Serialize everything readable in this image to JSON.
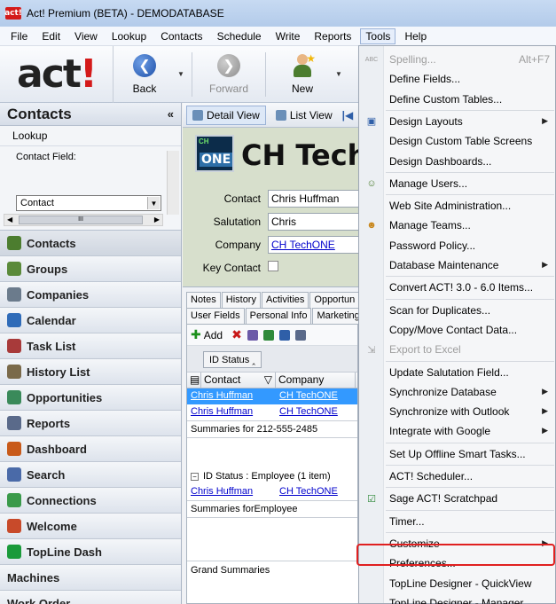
{
  "window": {
    "app_icon": "act!",
    "title": "Act! Premium (BETA) - DEMODATABASE"
  },
  "menubar": {
    "items": [
      {
        "label": "File"
      },
      {
        "label": "Edit"
      },
      {
        "label": "View"
      },
      {
        "label": "Lookup"
      },
      {
        "label": "Contacts"
      },
      {
        "label": "Schedule"
      },
      {
        "label": "Write"
      },
      {
        "label": "Reports"
      },
      {
        "label": "Tools",
        "active": true
      },
      {
        "label": "Help"
      }
    ]
  },
  "toolbar": {
    "logo_text": "act",
    "logo_bang": "!",
    "back_label": "Back",
    "forward_label": "Forward",
    "new_label": "New"
  },
  "leftnav": {
    "header": "Contacts",
    "collapse_glyph": "«",
    "lookup": {
      "title": "Lookup",
      "field_label": "Contact Field:",
      "field_value": "Contact",
      "scroll_thumb": "III"
    },
    "items": [
      {
        "label": "Contacts",
        "icon": "contacts-icon",
        "color": "#4c7d2f"
      },
      {
        "label": "Groups",
        "icon": "groups-icon",
        "color": "#5a8a3a"
      },
      {
        "label": "Companies",
        "icon": "companies-icon",
        "color": "#6b7b8c"
      },
      {
        "label": "Calendar",
        "icon": "calendar-icon",
        "color": "#2f6bb8"
      },
      {
        "label": "Task List",
        "icon": "task-list-icon",
        "color": "#a83a3a"
      },
      {
        "label": "History List",
        "icon": "history-list-icon",
        "color": "#7a6a4a"
      },
      {
        "label": "Opportunities",
        "icon": "opportunities-icon",
        "color": "#3a8a5a"
      },
      {
        "label": "Reports",
        "icon": "reports-icon",
        "color": "#5a6a8a"
      },
      {
        "label": "Dashboard",
        "icon": "dashboard-icon",
        "color": "#c85a1a"
      },
      {
        "label": "Search",
        "icon": "search-icon",
        "color": "#4a6aa8"
      },
      {
        "label": "Connections",
        "icon": "connections-icon",
        "color": "#3a9a4a"
      },
      {
        "label": "Welcome",
        "icon": "welcome-icon",
        "color": "#c84a2a"
      },
      {
        "label": "TopLine Dash",
        "icon": "topline-dash-icon",
        "color": "#1a9a3a"
      },
      {
        "label": "Machines",
        "icon": "",
        "color": ""
      },
      {
        "label": "Work Order",
        "icon": "",
        "color": ""
      }
    ]
  },
  "main": {
    "tabs": [
      {
        "label": "Detail View"
      },
      {
        "label": "List View"
      }
    ],
    "company_logo_top": "CH",
    "company_logo_bottom": "ONE",
    "company_header": "CH Tech",
    "fields": [
      {
        "label": "Contact",
        "value": "Chris Huffman",
        "link": false
      },
      {
        "label": "Salutation",
        "value": "Chris",
        "link": false
      },
      {
        "label": "Company",
        "value": "CH TechONE",
        "link": true
      }
    ],
    "key_contact_label": "Key Contact",
    "subtabs_row1": [
      "Notes",
      "History",
      "Activities",
      "Opportun"
    ],
    "subtabs_row2": [
      "User Fields",
      "Personal Info",
      "Marketing"
    ],
    "add_label": "Add",
    "group_chip": "ID Status",
    "grid_columns": [
      "Contact",
      "Company"
    ],
    "rows_group1": [
      {
        "contact": "Chris Huffman",
        "company": "CH TechONE",
        "selected": true
      },
      {
        "contact": "Chris Huffman",
        "company": "CH TechONE",
        "selected": false
      }
    ],
    "summary1": "Summaries for 212-555-2485",
    "group2_label": "ID Status : Employee (1 item)",
    "rows_group2": [
      {
        "contact": "Chris Huffman",
        "company": "CH TechONE",
        "selected": false
      }
    ],
    "summary2": "Summaries forEmployee",
    "grand_summaries": "Grand Summaries"
  },
  "tools_menu": {
    "items": [
      {
        "label": "Spelling...",
        "shortcut": "Alt+F7",
        "disabled": true,
        "icon": "spelling-icon"
      },
      {
        "label": "Define Fields..."
      },
      {
        "label": "Define Custom Tables..."
      },
      {
        "sep": true
      },
      {
        "label": "Design Layouts",
        "submenu": true,
        "icon": "design-layouts-icon"
      },
      {
        "label": "Design Custom Table Screens"
      },
      {
        "label": "Design Dashboards..."
      },
      {
        "sep": true
      },
      {
        "label": "Manage Users...",
        "icon": "manage-users-icon"
      },
      {
        "sep": true
      },
      {
        "label": "Web Site Administration..."
      },
      {
        "label": "Manage Teams...",
        "icon": "manage-teams-icon"
      },
      {
        "label": "Password Policy..."
      },
      {
        "label": "Database Maintenance",
        "submenu": true
      },
      {
        "sep": true
      },
      {
        "label": "Convert ACT! 3.0 - 6.0 Items..."
      },
      {
        "sep": true
      },
      {
        "label": "Scan for Duplicates..."
      },
      {
        "label": "Copy/Move Contact Data..."
      },
      {
        "label": "Export to Excel",
        "disabled": true,
        "icon": "export-excel-icon"
      },
      {
        "sep": true
      },
      {
        "label": "Update Salutation Field..."
      },
      {
        "label": "Synchronize Database",
        "submenu": true
      },
      {
        "label": "Synchronize with Outlook",
        "submenu": true
      },
      {
        "label": "Integrate with Google",
        "submenu": true
      },
      {
        "sep": true
      },
      {
        "label": "Set Up Offline Smart Tasks..."
      },
      {
        "sep": true
      },
      {
        "label": "ACT! Scheduler..."
      },
      {
        "sep": true
      },
      {
        "label": "Sage ACT! Scratchpad",
        "icon": "scratchpad-icon"
      },
      {
        "sep": true
      },
      {
        "label": "Timer..."
      },
      {
        "sep": true
      },
      {
        "label": "Customize",
        "submenu": true
      },
      {
        "label": "Preferences...",
        "highlighted": true
      },
      {
        "label": "TopLine Designer - QuickView"
      },
      {
        "label": "TopLine Designer - Manager"
      }
    ]
  }
}
